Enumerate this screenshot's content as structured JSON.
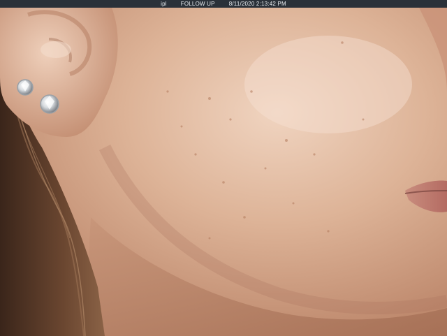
{
  "topbar": {
    "segments": [
      "ipl",
      "FOLLOW UP",
      "8/11/2020 2:13:42 PM"
    ]
  },
  "colors": {
    "bar_bg": "#2a3139",
    "bar_text": "#e9edf1",
    "skin_light": "#e9c9b2",
    "skin_mid": "#d6aa8c",
    "skin_shadow": "#b98266",
    "hair": "#4a3122"
  },
  "photo": {
    "subject": "close-up of face: ear with two stud earrings, cheek, jaw, lips",
    "icons": [
      "earring-icon",
      "earring-icon"
    ]
  }
}
